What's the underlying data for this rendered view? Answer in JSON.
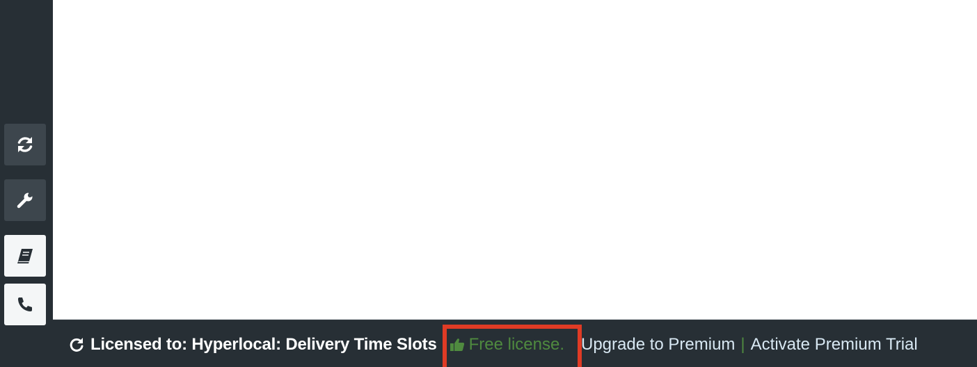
{
  "sidebar": {
    "buttons": [
      {
        "icon": "refresh-icon",
        "style": "dark"
      },
      {
        "icon": "wrench-icon",
        "style": "dark"
      },
      {
        "icon": "book-icon",
        "style": "light"
      },
      {
        "icon": "phone-icon",
        "style": "light"
      }
    ]
  },
  "footer": {
    "licensed_text": "Licensed to: Hyperlocal: Delivery Time Slots",
    "free_license": "Free license.",
    "upgrade_link": "Upgrade to Premium",
    "separator": "|",
    "trial_link": "Activate Premium Trial"
  },
  "colors": {
    "sidebar_bg": "#272f35",
    "accent_green": "#4f8a3f",
    "highlight_red": "#e03b25",
    "link": "#d8e8f3"
  }
}
